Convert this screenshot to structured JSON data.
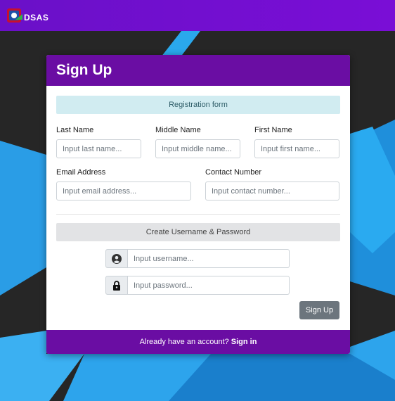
{
  "app": {
    "logo_text": "DSAS",
    "brand_color": "#6a0da3"
  },
  "card": {
    "title": "Sign Up",
    "registration_banner": "Registration form",
    "fields": {
      "last_name": {
        "label": "Last Name",
        "placeholder": "Input last name..."
      },
      "middle_name": {
        "label": "Middle Name",
        "placeholder": "Input middle name..."
      },
      "first_name": {
        "label": "First Name",
        "placeholder": "Input first name..."
      },
      "email": {
        "label": "Email Address",
        "placeholder": "Input email address..."
      },
      "contact": {
        "label": "Contact Number",
        "placeholder": "Input contact number..."
      }
    },
    "credentials_banner": "Create Username & Password",
    "username": {
      "placeholder": "Input username...",
      "icon": "user-circle-icon"
    },
    "password": {
      "placeholder": "Input password...",
      "icon": "lock-icon"
    },
    "submit_label": "Sign Up",
    "footer": {
      "text": "Already have an account?",
      "link": "Sign in"
    }
  }
}
